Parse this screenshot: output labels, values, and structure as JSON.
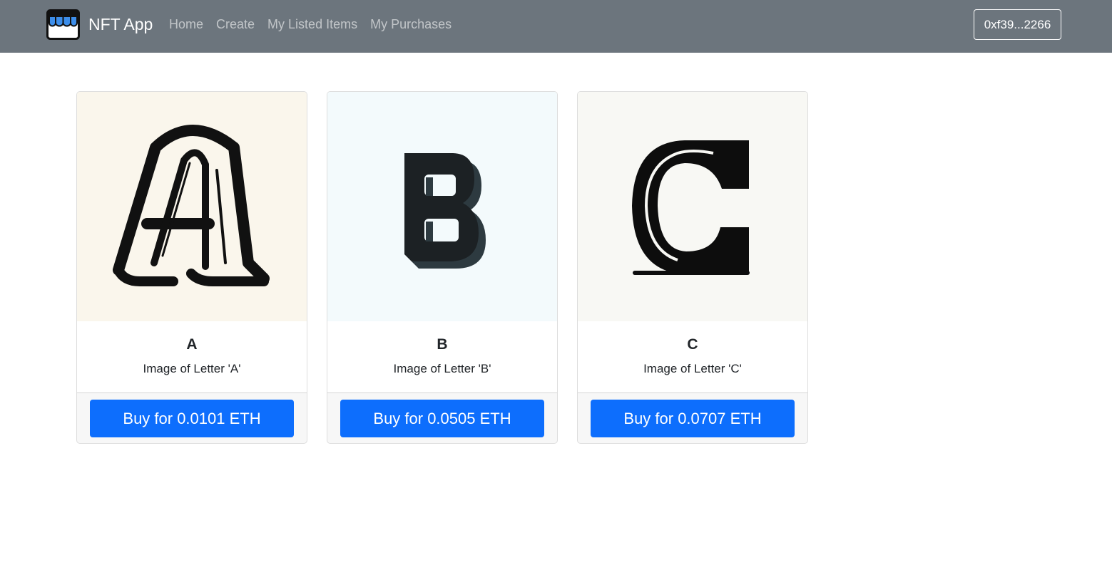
{
  "navbar": {
    "brand_text": "NFT App",
    "brand_icon": "storefront-icon",
    "links": [
      {
        "label": "Home"
      },
      {
        "label": "Create"
      },
      {
        "label": "My Listed Items"
      },
      {
        "label": "My Purchases"
      }
    ],
    "account_label": "0xf39...2266"
  },
  "items": [
    {
      "title": "A",
      "description": "Image of Letter 'A'",
      "button_label": "Buy for 0.0101 ETH"
    },
    {
      "title": "B",
      "description": "Image of Letter 'B'",
      "button_label": "Buy for 0.0505 ETH"
    },
    {
      "title": "C",
      "description": "Image of Letter 'C'",
      "button_label": "Buy for 0.0707 ETH"
    }
  ],
  "colors": {
    "navbar_bg": "#6c757d",
    "primary": "#0d6efd",
    "card_a_bg": "#faf6ec",
    "card_b_bg": "#f3fafc",
    "card_c_bg": "#f8f8f4"
  }
}
